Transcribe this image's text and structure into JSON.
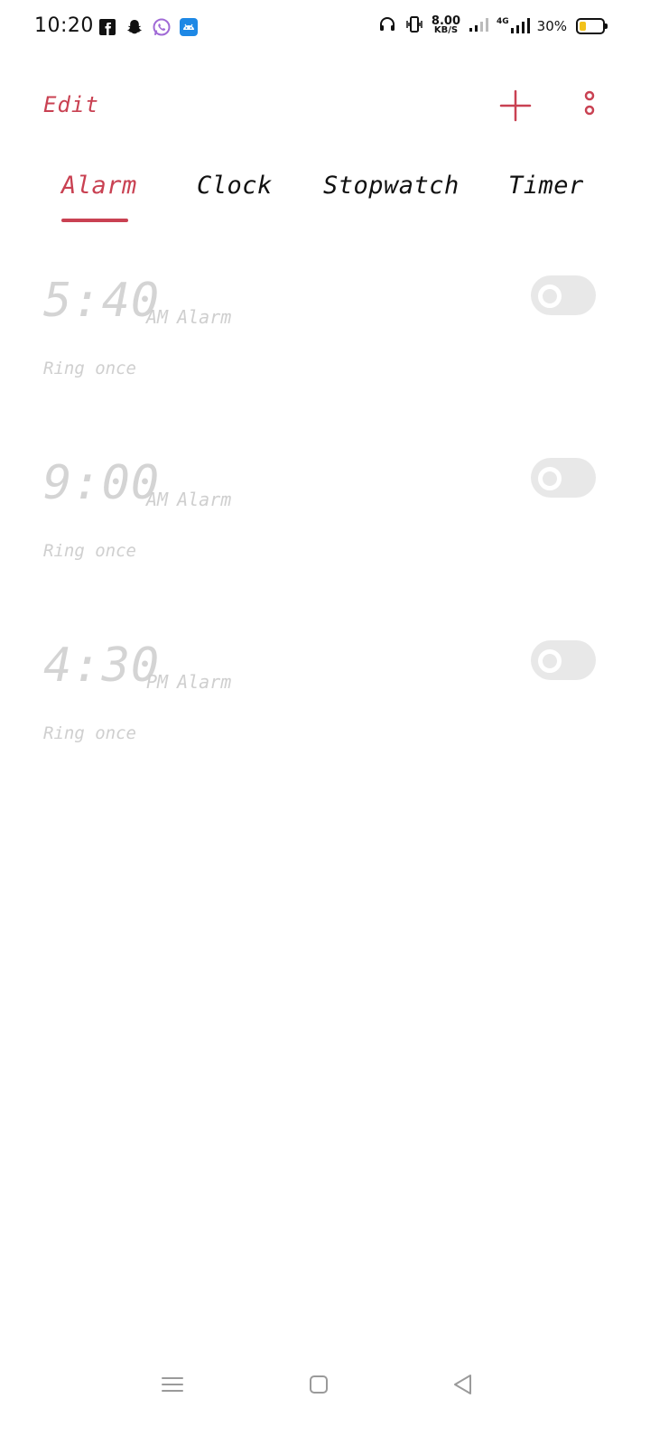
{
  "status_bar": {
    "time": "10:20",
    "notification_apps": [
      "facebook-icon",
      "snapchat-icon",
      "whatsapp-icon",
      "android-app-icon"
    ],
    "net_speed_value": "8.00",
    "net_speed_unit": "KB/S",
    "network_label": "4G",
    "battery_percent": "30%",
    "battery_level": 0.3,
    "icons": [
      "headphones-icon",
      "vibrate-icon",
      "signal-icon",
      "signal-4g-icon",
      "battery-icon"
    ]
  },
  "toolbar": {
    "edit_label": "Edit",
    "add_icon": "plus-icon",
    "more_icon": "more-vertical-icon",
    "accent_color": "#c94152"
  },
  "tabs": [
    {
      "label": "Alarm",
      "active": true
    },
    {
      "label": "Clock",
      "active": false
    },
    {
      "label": "Stopwatch",
      "active": false
    },
    {
      "label": "Timer",
      "active": false
    }
  ],
  "alarms": [
    {
      "time": "5:40",
      "period": "AM",
      "label": "Alarm",
      "repeat": "Ring once",
      "enabled": false
    },
    {
      "time": "9:00",
      "period": "AM",
      "label": "Alarm",
      "repeat": "Ring once",
      "enabled": false
    },
    {
      "time": "4:30",
      "period": "PM",
      "label": "Alarm",
      "repeat": "Ring once",
      "enabled": false
    }
  ],
  "nav_bar": {
    "buttons": [
      "menu-icon",
      "home-icon",
      "back-icon"
    ]
  }
}
